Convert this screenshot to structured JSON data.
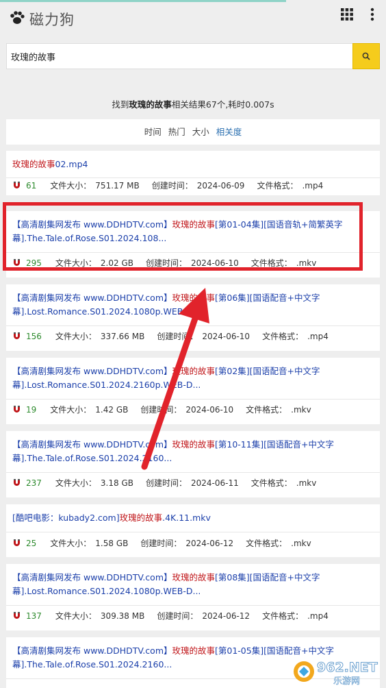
{
  "app": {
    "title": "磁力狗"
  },
  "search": {
    "query": "玫瑰的故事"
  },
  "summary": {
    "prefix": "找到",
    "keyword": "玫瑰的故事",
    "suffix": "相关结果67个,耗时0.007s"
  },
  "sort": {
    "options": [
      "时间",
      "热门",
      "大小",
      "相关度"
    ],
    "active": "相关度"
  },
  "labels": {
    "size": "文件大小：",
    "created": "创建时间：",
    "format": "文件格式："
  },
  "results": [
    {
      "title_pre": "",
      "title_hl": "玫瑰的故事",
      "title_post": "02.mp4",
      "count": "61",
      "size": "751.17 MB",
      "date": "2024-06-09",
      "format": ".mp4"
    },
    {
      "title_pre": "【高清剧集网发布 www.DDHDTV.com】",
      "title_hl": "玫瑰的故事",
      "title_post": "[第01-04集][国语音轨+简繁英字幕].The.Tale.of.Rose.S01.2024.108...",
      "count": "295",
      "size": "2.02 GB",
      "date": "2024-06-10",
      "format": ".mkv"
    },
    {
      "title_pre": "【高清剧集网发布 www.DDHDTV.com】",
      "title_hl": "玫瑰的故事",
      "title_post": "[第06集][国语配音+中文字幕].Lost.Romance.S01.2024.1080p.WEB-D...",
      "count": "156",
      "size": "337.66 MB",
      "date": "2024-06-10",
      "format": ".mp4"
    },
    {
      "title_pre": "【高清剧集网发布 www.DDHDTV.com】",
      "title_hl": "玫瑰的故事",
      "title_post": "[第02集][国语配音+中文字幕].Lost.Romance.S01.2024.2160p.WEB-D...",
      "count": "19",
      "size": "1.42 GB",
      "date": "2024-06-10",
      "format": ".mkv"
    },
    {
      "title_pre": "【高清剧集网发布 www.DDHDTV.com】",
      "title_hl": "玫瑰的故事",
      "title_post": "[第10-11集][国语配音+中文字幕].The.Tale.of.Rose.S01.2024.2160...",
      "count": "237",
      "size": "3.18 GB",
      "date": "2024-06-11",
      "format": ".mkv"
    },
    {
      "title_pre": "[酷吧电影：kubady2.com]",
      "title_hl": "玫瑰的故事",
      "title_post": ".4K.11.mkv",
      "count": "25",
      "size": "1.58 GB",
      "date": "2024-06-12",
      "format": ".mkv"
    },
    {
      "title_pre": "【高清剧集网发布 www.DDHDTV.com】",
      "title_hl": "玫瑰的故事",
      "title_post": "[第08集][国语配音+中文字幕].Lost.Romance.S01.2024.1080p.WEB-D...",
      "count": "137",
      "size": "309.38 MB",
      "date": "2024-06-12",
      "format": ".mp4"
    },
    {
      "title_pre": "【高清剧集网发布 www.DDHDTV.com】",
      "title_hl": "玫瑰的故事",
      "title_post": "[第01-05集][国语配音+中文字幕].The.Tale.of.Rose.S01.2024.2160...",
      "count": "",
      "size": "",
      "date": "",
      "format": ""
    }
  ],
  "watermark": {
    "text": "962.NET",
    "sub": "乐游网"
  },
  "colors": {
    "accent": "#f5cc1c",
    "link": "#1b3faa",
    "highlight": "#c0161a",
    "count": "#2c8a2c",
    "annotation": "#e1232b"
  }
}
